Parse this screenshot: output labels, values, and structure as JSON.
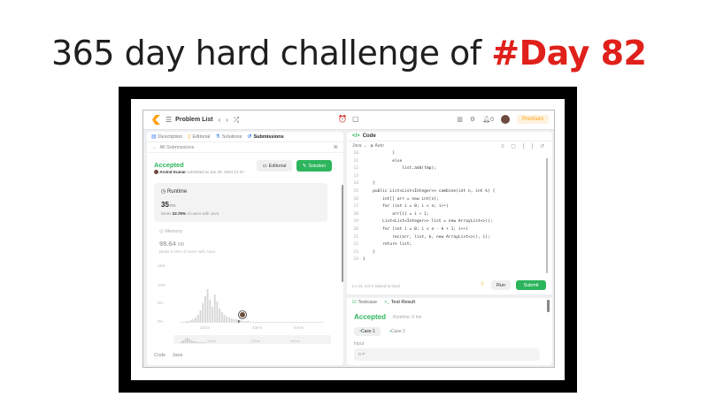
{
  "slide": {
    "title_prefix": "365 day hard challenge of ",
    "title_highlight": "#Day 82",
    "highlight_color": "#e0201b"
  },
  "topbar": {
    "problem_list": "Problem List",
    "notif_count": "0",
    "premium": "Premium"
  },
  "left_tabs": [
    {
      "label": "Description",
      "icon": "doc-icon"
    },
    {
      "label": "Editorial",
      "icon": "book-icon"
    },
    {
      "label": "Solutions",
      "icon": "flask-icon"
    },
    {
      "label": "Submissions",
      "icon": "history-icon"
    }
  ],
  "back": {
    "label": "All Submissions"
  },
  "submission": {
    "status": "Accepted",
    "user": "Arvind Kumar",
    "submitted_text": "submitted at Jan 29, 2024 21:37",
    "editorial_button": "Editorial",
    "solution_button": "Solution"
  },
  "runtime": {
    "label": "Runtime",
    "value": "35",
    "unit": "ms",
    "beats_prefix": "Beats ",
    "beats_pct": "22.75%",
    "beats_suffix": " of users with Java"
  },
  "memory": {
    "label": "Memory",
    "value": "98.64",
    "unit": "MB",
    "beats_text": "Beats 8.15% of users with Java"
  },
  "histogram": {
    "y_ticks": [
      "15%",
      "10%",
      "5%",
      "0%"
    ],
    "x_ticks": [
      "22ms",
      "43ms",
      "64ms"
    ],
    "mini_x_ticks": [
      "22ms",
      "43ms",
      "64ms"
    ]
  },
  "code_lang_label": "Code",
  "code_lang_value": "Java",
  "code_panel": {
    "title": "Code",
    "language": "Java",
    "auto": "Auto",
    "lines": [
      {
        "n": "10",
        "text": "            }"
      },
      {
        "n": "11",
        "text": "            else"
      },
      {
        "n": "12",
        "text": "                list.add(tmp);"
      },
      {
        "n": "13",
        "text": ""
      },
      {
        "n": "14",
        "text": "    }"
      },
      {
        "n": "15",
        "text": "    public List<List<Integer>> combine(int n, int k) {"
      },
      {
        "n": "16",
        "text": "        int[] arr = new int[n];"
      },
      {
        "n": "17",
        "text": "        for (int i = 0; i < n; i++)"
      },
      {
        "n": "18",
        "text": "            arr[i] = i + 1;"
      },
      {
        "n": "19",
        "text": "        List<List<Integer>> list = new ArrayList<>();"
      },
      {
        "n": "20",
        "text": "        for (int i = 0; i < n - k + 1; i++)"
      },
      {
        "n": "21",
        "text": "            rec(arr, list, k, new ArrayList<>(), i);"
      },
      {
        "n": "22",
        "text": "        return list;"
      },
      {
        "n": "23",
        "text": "    }"
      },
      {
        "n": "24",
        "text": "}"
      }
    ],
    "status": "Ln 24, Col 2   Saved to local",
    "run": "Run",
    "submit": "Submit"
  },
  "tests": {
    "testcase_tab": "Testcase",
    "result_tab": "Test Result",
    "status": "Accepted",
    "runtime": "Runtime: 0 ms",
    "case1": "Case 1",
    "case2": "Case 2",
    "input_label": "Input",
    "input_value": "n ="
  }
}
